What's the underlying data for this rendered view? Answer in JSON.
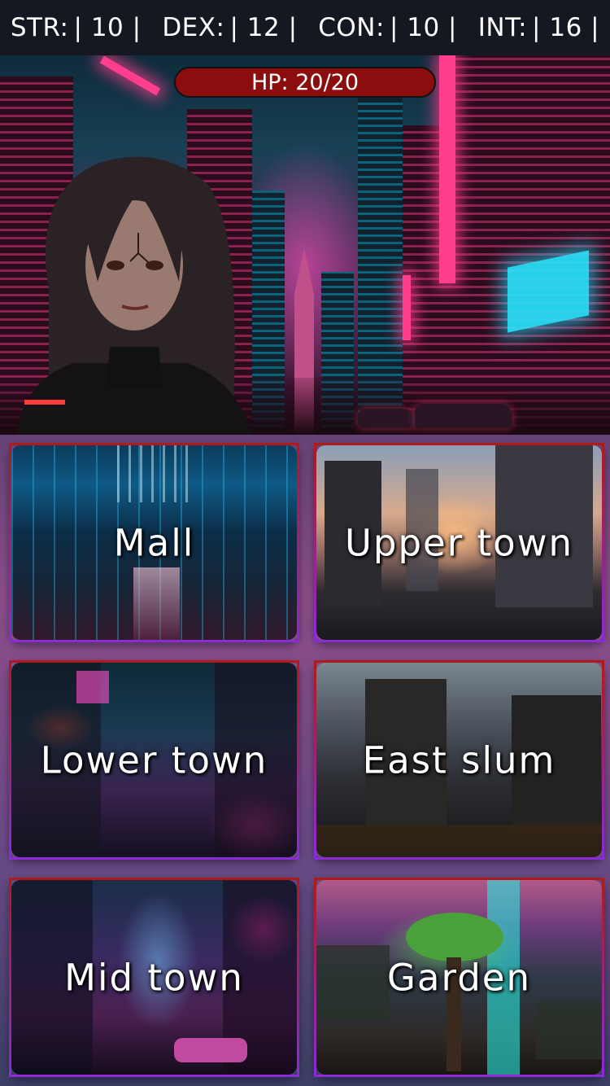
{
  "stats": [
    {
      "label": "STR:",
      "value": "10"
    },
    {
      "label": "DEX:",
      "value": "12"
    },
    {
      "label": "CON:",
      "value": "10"
    },
    {
      "label": "INT:",
      "value": "16"
    }
  ],
  "hp": {
    "text": "HP: 20/20",
    "current": 20,
    "max": 20
  },
  "locations": [
    {
      "label": "Mall"
    },
    {
      "label": "Upper town"
    },
    {
      "label": "Lower town"
    },
    {
      "label": "East slum"
    },
    {
      "label": "Mid town"
    },
    {
      "label": "Garden"
    }
  ],
  "colors": {
    "hp_bar": "#8b0d0d",
    "stat_bar": "#151820",
    "tile_border_top": "#b01a1a",
    "tile_border_bottom": "#8a2bd8"
  }
}
